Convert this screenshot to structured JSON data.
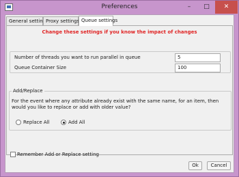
{
  "window": {
    "title": "Preferences",
    "minimize": "–",
    "maximize": "□",
    "close": "✕"
  },
  "tabs": [
    {
      "label": "General settings",
      "selected": false
    },
    {
      "label": "Proxy settings",
      "selected": false
    },
    {
      "label": "Queue settings",
      "selected": true
    }
  ],
  "queue": {
    "warning": "Change these settings if you know the impact of changes",
    "threads_label": "Number of threads you want to run parallel in queue",
    "threads_value": "5",
    "container_label": "Queue Container Size",
    "container_value": "100"
  },
  "add_replace": {
    "group_title": "Add/Replace",
    "description": "For the event where any attribute already exist with the same name, for an item, then would you like to replace or add with older value?",
    "options": [
      {
        "label": "Replace All",
        "selected": false
      },
      {
        "label": "Add All",
        "selected": true
      }
    ]
  },
  "remember": {
    "label": "Remember Add or Replace setting",
    "checked": false
  },
  "buttons": {
    "ok": "Ok",
    "cancel": "Cancel"
  },
  "colors": {
    "titlebar": "#c795cc",
    "close_button": "#c7504d",
    "warning_text": "#e02424"
  }
}
